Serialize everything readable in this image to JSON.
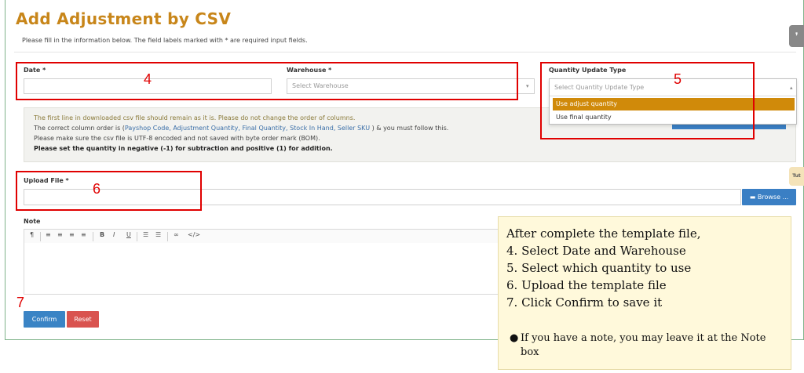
{
  "page": {
    "title": "Add Adjustment by CSV",
    "intro": "Please fill in the information below. The field labels marked with * are required input fields."
  },
  "form": {
    "date_label": "Date *",
    "warehouse_label": "Warehouse *",
    "warehouse_placeholder": "Select Warehouse",
    "qty_type_label": "Quantity Update Type",
    "qty_type_placeholder": "Select Quantity Update Type",
    "qty_type_options": [
      "Use adjust quantity",
      "Use final quantity"
    ],
    "upload_label": "Upload File *",
    "browse_label": "Browse ...",
    "note_label": "Note"
  },
  "info": {
    "line1": "The first line in downloaded csv file should remain as it is. Please do not change the order of columns.",
    "line2_pre": "The correct column order is (",
    "line2_cols": "Payshop Code, Adjustment Quantity, Final Quantity, Stock In Hand, Seller SKU",
    "line2_post": " ) & you must follow this.",
    "line3": "Please make sure the csv file is UTF-8 encoded and not saved with byte order mark (BOM).",
    "line4": "Please set the quantity in negative (-1) for subtraction and positive (1) for addition."
  },
  "toolbar": {
    "items": [
      "¶",
      "≡",
      "≡",
      "≡",
      "≡",
      "B",
      "I",
      "U",
      "☰",
      "☰",
      "∞",
      "</>"
    ]
  },
  "actions": {
    "confirm": "Confirm",
    "reset": "Reset"
  },
  "side_tabs": {
    "tutorial": "Tut"
  },
  "annotations": {
    "n4": "4",
    "n5": "5",
    "n6": "6",
    "n7": "7"
  },
  "instructions": {
    "heading": "After complete the template file,",
    "steps": [
      "4. Select Date and Warehouse",
      "5. Select which quantity to use",
      "6. Upload the template file",
      "7. Click Confirm to save it"
    ],
    "bullet": "If you have a note, you may leave it at the Note box"
  },
  "colors": {
    "title": "#c8861a",
    "primary": "#3a84c5",
    "danger": "#d9534f",
    "highlight": "#d08a0a",
    "annotation": "#e00000",
    "note_bg": "#fff9db"
  }
}
